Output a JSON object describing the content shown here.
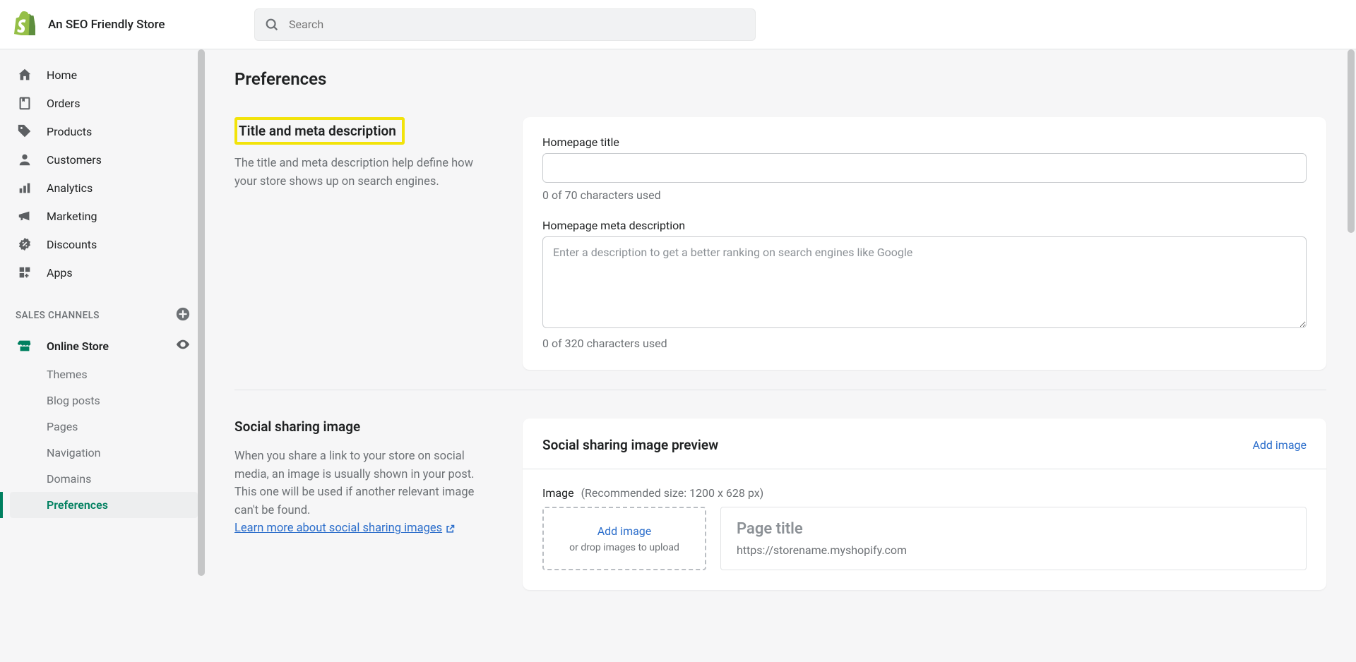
{
  "topbar": {
    "store_name": "An SEO Friendly Store",
    "search_placeholder": "Search"
  },
  "sidebar": {
    "main_nav": [
      {
        "label": "Home"
      },
      {
        "label": "Orders"
      },
      {
        "label": "Products"
      },
      {
        "label": "Customers"
      },
      {
        "label": "Analytics"
      },
      {
        "label": "Marketing"
      },
      {
        "label": "Discounts"
      },
      {
        "label": "Apps"
      }
    ],
    "channels_header": "SALES CHANNELS",
    "channel_label": "Online Store",
    "sub_items": [
      {
        "label": "Themes"
      },
      {
        "label": "Blog posts"
      },
      {
        "label": "Pages"
      },
      {
        "label": "Navigation"
      },
      {
        "label": "Domains"
      },
      {
        "label": "Preferences"
      }
    ]
  },
  "main": {
    "page_title": "Preferences",
    "section1": {
      "heading": "Title and meta description",
      "desc": "The title and meta description help define how your store shows up on search engines.",
      "title_label": "Homepage title",
      "title_hint": "0 of 70 characters used",
      "meta_label": "Homepage meta description",
      "meta_placeholder": "Enter a description to get a better ranking on search engines like Google",
      "meta_hint": "0 of 320 characters used"
    },
    "section2": {
      "heading": "Social sharing image",
      "desc_pre": "When you share a link to your store on social media, an image is usually shown in your post. This one will be used if another relevant image can't be found. ",
      "desc_link": "Learn more about social sharing images",
      "card_header": "Social sharing image preview",
      "add_image": "Add image",
      "image_label": "Image",
      "image_rec": "(Recommended size: 1200 x 628 px)",
      "drop_link": "Add image",
      "drop_sub": "or drop images to upload",
      "preview_title": "Page title",
      "preview_url": "https://storename.myshopify.com"
    }
  }
}
